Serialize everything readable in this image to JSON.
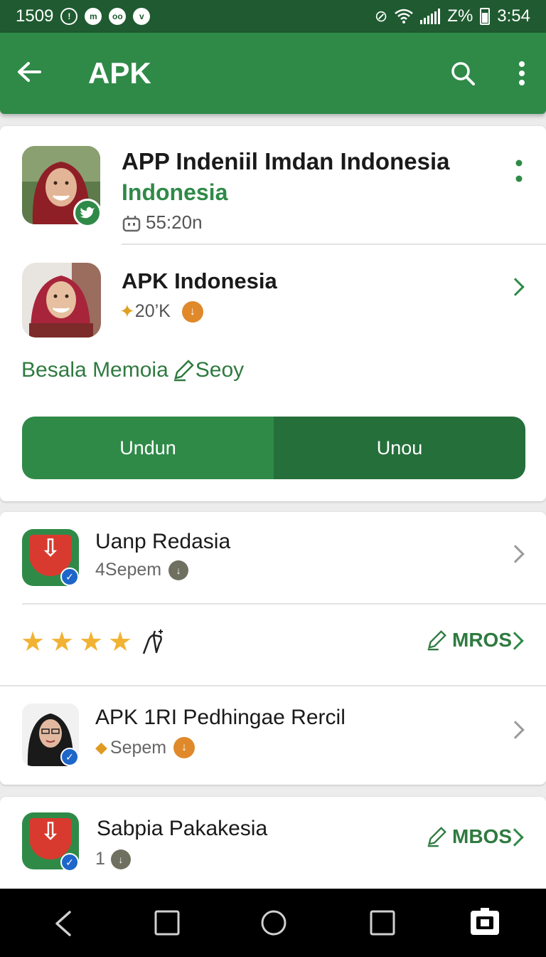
{
  "status_bar": {
    "time_left": "1509",
    "battery_percent": "Z%",
    "clock": "3:54"
  },
  "app_bar": {
    "title": "APK",
    "back_icon": "arrow-left-icon",
    "search_icon": "search-icon",
    "more_icon": "more-vert-icon"
  },
  "featured": {
    "app1": {
      "title": "APP Indeniil Imdan Indonesia",
      "subtitle": "Indonesia",
      "meta": "55:20n"
    },
    "app2": {
      "title": "APK Indonesia",
      "meta": "20’K"
    },
    "link_text": "Besala Memoia",
    "link_suffix": "Seoy",
    "button_left": "Undun",
    "button_right": "Unou"
  },
  "list": [
    {
      "title": "Uanp Redasia",
      "meta": "4Sepem"
    },
    {
      "title": "APK 1RI Pedhingae Rercil",
      "meta": "Sepem"
    },
    {
      "title": "Sabpia Pakakesia",
      "meta": "1"
    }
  ],
  "rating": {
    "stars": 4,
    "action_label": "MROS"
  },
  "action_label_2": "MBOS",
  "colors": {
    "primary": "#2f8a48",
    "primary_dark": "#256f3a",
    "status_bar": "#1f5a30",
    "star": "#f2b233",
    "coin": "#e0892a"
  }
}
